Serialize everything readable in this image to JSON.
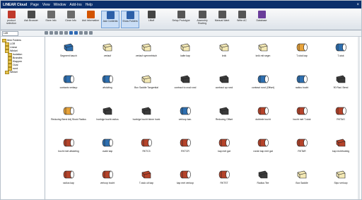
{
  "window": {
    "title": "LINEAR Cloud",
    "menus": [
      "Page",
      "View",
      "Window",
      "Add-Ins",
      "Help"
    ],
    "close_glyph": "×"
  },
  "ribbon": {
    "buttons": [
      {
        "label": "product selection",
        "icon": "product-icon",
        "color": "#c0392b"
      },
      {
        "label": "Ask Browser",
        "icon": "browser-icon",
        "color": "#4a4a4a"
      },
      {
        "label": "Store Info",
        "icon": "store-icon",
        "color": "#6b6b6b"
      },
      {
        "label": "Close Info",
        "icon": "close-info-icon",
        "color": "#6b6b6b"
      },
      {
        "label": "Ask Information",
        "icon": "info-icon",
        "color": "#d35400"
      },
      {
        "label": "Ask Contents",
        "icon": "contents-icon",
        "color": "#2c5fa8",
        "active": true
      },
      {
        "label": "Show Folders",
        "icon": "folders-icon",
        "color": "#2c5fa8",
        "active": true
      },
      {
        "label": "Liftoff",
        "icon": "liftoff-icon",
        "color": "#444444"
      },
      {
        "label": "Setup Prototype",
        "icon": "setup-icon",
        "color": "#555555"
      },
      {
        "label": "Assembly Routing",
        "icon": "assembly-icon",
        "color": "#555555"
      },
      {
        "label": "Manual Want",
        "icon": "manual-icon",
        "color": "#555555"
      },
      {
        "label": "Write AC",
        "icon": "write-icon",
        "color": "#555555"
      },
      {
        "label": "Database",
        "icon": "database-icon",
        "color": "#6a3d9a"
      }
    ]
  },
  "pathbar": {
    "dropdown": "Lüft"
  },
  "sidebar": {
    "tree": [
      {
        "label": "Item Folders",
        "level": 0
      },
      {
        "label": "LGR",
        "level": 1
      },
      {
        "label": "Linear",
        "level": 1
      },
      {
        "label": "Winkel",
        "level": 1
      },
      {
        "label": "Isolation",
        "level": 2
      },
      {
        "label": "Brandes",
        "level": 2
      },
      {
        "label": "Klappen",
        "level": 2
      },
      {
        "label": "Oval",
        "level": 2
      },
      {
        "label": "rund",
        "level": 2
      },
      {
        "label": "Winkel",
        "level": 1
      }
    ]
  },
  "grid": {
    "items": [
      {
        "label": "Segment bauch",
        "shape": "rect-duct",
        "color": "#2e6fb0"
      },
      {
        "label": "verlauf",
        "shape": "rect-duct",
        "color": "#f4e9b5"
      },
      {
        "label": "verlauf symmetrisch",
        "shape": "rect-duct",
        "color": "#f4e9b5"
      },
      {
        "label": "kalte kap",
        "shape": "rect-duct",
        "color": "#f4e9b5"
      },
      {
        "label": "knik",
        "shape": "rect-duct",
        "color": "#f4e9b5"
      },
      {
        "label": "knik mit segm",
        "shape": "rect-duct",
        "color": "#f4e9b5"
      },
      {
        "label": "T-stuk kap",
        "shape": "round-duct",
        "color": "#e8a33a"
      },
      {
        "label": "T-stuk",
        "shape": "round-duct",
        "color": "#2e6fb0"
      },
      {
        "label": "contacts verlaup",
        "shape": "round-duct",
        "color": "#2e6fb0"
      },
      {
        "label": "afsluiting",
        "shape": "round-duct",
        "color": "#2e6fb0"
      },
      {
        "label": "Box Saddle Tangential",
        "shape": "rect-duct",
        "color": "#f4e9b5"
      },
      {
        "label": "contract to oval rond",
        "shape": "rect-duct",
        "color": "#3a3a3a"
      },
      {
        "label": "contract up rond",
        "shape": "rect-duct",
        "color": "#3a3a3a"
      },
      {
        "label": "contract rond (Offset)",
        "shape": "round-duct",
        "color": "#2e6fb0"
      },
      {
        "label": "radius bocht",
        "shape": "round-duct",
        "color": "#2e6fb0"
      },
      {
        "label": "90 Rad. Bend",
        "shape": "rect-duct",
        "color": "#3a3a3a"
      },
      {
        "label": "Reducing Bend Adj Stock Radius",
        "shape": "round-duct",
        "color": "#e8a33a"
      },
      {
        "label": "hoekige bocht radius",
        "shape": "rect-duct",
        "color": "#3a3a3a"
      },
      {
        "label": "hoekige bocht binne hoek",
        "shape": "rect-duct",
        "color": "#3a3a3a"
      },
      {
        "label": "verloop kan.",
        "shape": "round-duct",
        "color": "#2e6fb0"
      },
      {
        "label": "Reducing Offset",
        "shape": "rect-duct",
        "color": "#3a3a3a"
      },
      {
        "label": "dubbele bocht",
        "shape": "round-duct",
        "color": "#b5432a"
      },
      {
        "label": "bocht met T-stuk",
        "shape": "round-duct",
        "color": "#b5432a"
      },
      {
        "label": "RKTAG",
        "shape": "round-duct",
        "color": "#b5432a"
      },
      {
        "label": "bocht met afsluiting",
        "shape": "round-duct",
        "color": "#b5432a"
      },
      {
        "label": "ovale kap",
        "shape": "round-duct",
        "color": "#2e6fb0"
      },
      {
        "label": "RKTC3",
        "shape": "round-duct",
        "color": "#b5432a"
      },
      {
        "label": "RKTCR",
        "shape": "round-duct",
        "color": "#b5432a"
      },
      {
        "label": "kap met gat",
        "shape": "round-duct",
        "color": "#b5432a"
      },
      {
        "label": "ronde kap met gat",
        "shape": "round-duct",
        "color": "#b5432a"
      },
      {
        "label": "RKTAR",
        "shape": "round-duct",
        "color": "#b5432a"
      },
      {
        "label": "kap rechthoekig",
        "shape": "rect-duct",
        "color": "#b5432a"
      },
      {
        "label": "radius kap",
        "shape": "round-duct",
        "color": "#b5432a"
      },
      {
        "label": "verloop bocht",
        "shape": "round-duct",
        "color": "#b5432a"
      },
      {
        "label": "T-stuk uit kap",
        "shape": "rect-duct",
        "color": "#b5432a"
      },
      {
        "label": "kap met verloop",
        "shape": "round-duct",
        "color": "#b5432a"
      },
      {
        "label": "RKTST",
        "shape": "round-duct",
        "color": "#b5432a"
      },
      {
        "label": "Radius Tee",
        "shape": "rect-duct",
        "color": "#3a3a3a"
      },
      {
        "label": "Box Saddle",
        "shape": "rect-duct",
        "color": "#f4e9b5"
      },
      {
        "label": "Stpo verloop",
        "shape": "rect-duct",
        "color": "#f4e9b5"
      }
    ]
  }
}
